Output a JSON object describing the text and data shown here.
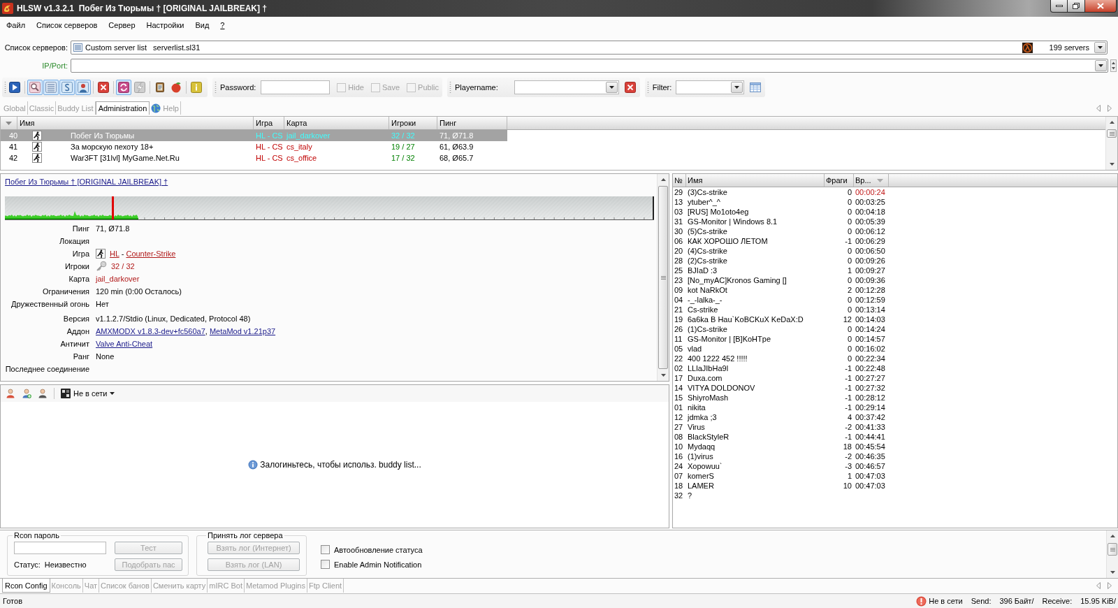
{
  "window": {
    "title": "HLSW v1.3.2.1  Побег Из Тюрьмы † [ORIGINAL JAILBREAK] †"
  },
  "menu": [
    {
      "label": "Файл",
      "underlined": false
    },
    {
      "label": "Список серверов",
      "underlined": false
    },
    {
      "label": "Сервер",
      "underlined": false
    },
    {
      "label": "Настройки",
      "underlined": false
    },
    {
      "label": "Вид",
      "underlined": false
    },
    {
      "label": "?",
      "underlined": true
    }
  ],
  "server_list": {
    "label": "Список серверов:",
    "list_type": "Custom server list",
    "file": "serverlist.sl31",
    "count": "199 servers"
  },
  "ip_port": {
    "label": "IP/Port:"
  },
  "toolbar": {
    "button_groups": [
      [
        {
          "pressed": false,
          "disabled": false
        }
      ],
      [
        {
          "pressed": true,
          "disabled": false
        },
        {
          "pressed": true,
          "disabled": false
        },
        {
          "pressed": true,
          "disabled": false
        },
        {
          "pressed": true,
          "disabled": false
        }
      ],
      [
        {
          "pressed": false,
          "disabled": false
        }
      ],
      [
        {
          "pressed": true,
          "disabled": false
        },
        {
          "pressed": false,
          "disabled": true
        }
      ],
      [
        {
          "pressed": false,
          "disabled": false
        },
        {
          "pressed": false,
          "disabled": false
        }
      ],
      [
        {
          "pressed": false,
          "disabled": false
        }
      ]
    ],
    "password": {
      "label": "Password:",
      "options": [
        {
          "label": "Hide",
          "checked": false,
          "disabled": true
        },
        {
          "label": "Save",
          "checked": false,
          "disabled": true
        },
        {
          "label": "Public",
          "checked": false,
          "disabled": true
        }
      ]
    },
    "playername": {
      "label": "Playername:"
    },
    "filter": {
      "label": "Filter:"
    }
  },
  "view_tabs": [
    {
      "label": "Global",
      "kind": "plain",
      "selected": false
    },
    {
      "label": "Classic",
      "kind": "plain",
      "selected": false
    },
    {
      "label": "Buddy List",
      "kind": "plain",
      "selected": false
    },
    {
      "label": "Administration",
      "kind": "plain",
      "selected": true
    },
    {
      "label": "Help",
      "kind": "web",
      "selected": false
    }
  ],
  "server_table": {
    "columns": [
      "Имя",
      "Игра",
      "Карта",
      "Игроки",
      "Пинг"
    ],
    "rows": [
      {
        "number": "40",
        "name": "Побег Из Тюрьмы",
        "game": "HL - CS",
        "map": "jail_darkover",
        "players": "32 / 32",
        "full": true,
        "ping": "71, Ø71.8",
        "selected": true
      },
      {
        "number": "41",
        "name": "За  морскую пехоту 18+",
        "game": "HL - CS",
        "map": "cs_italy",
        "players": "19 / 27",
        "full": false,
        "ping": "61, Ø63.9",
        "selected": false
      },
      {
        "number": "42",
        "name": "War3FT [31lvl] MyGame.Net.Ru",
        "game": "HL - CS",
        "map": "cs_office",
        "players": "17 / 32",
        "full": false,
        "ping": "68, Ø65.7",
        "selected": false
      }
    ]
  },
  "details": {
    "title": "Побег Из Тюрьмы † [ORIGINAL JAILBREAK] †",
    "field_groups": [
      [
        {
          "kind": "text",
          "label": "Пинг",
          "value": "71, Ø71.8"
        },
        {
          "kind": "text",
          "label": "Локация"
        },
        {
          "kind": "game",
          "label": "Игра",
          "links": [
            "HL",
            "Counter-Strike"
          ],
          "separator": " - "
        },
        {
          "kind": "players",
          "label": "Игроки",
          "value": "32 / 32"
        },
        {
          "kind": "map",
          "label": "Карта",
          "value": "jail_darkover"
        },
        {
          "kind": "text",
          "label": "Ограничения",
          "value": "120 min (0:00 Осталось)"
        },
        {
          "kind": "text",
          "label": "Дружественный огонь",
          "value": "Нет"
        }
      ],
      [
        {
          "kind": "text",
          "label": "Версия",
          "value": "v1.1.2.7/Stdio (Linux, Dedicated, Protocol 48)"
        },
        {
          "kind": "links",
          "label": "Аддон",
          "links": [
            "AMXMODX v1.8.3-dev+fc560a7",
            "MetaMod v1.21p37"
          ],
          "separator": ", "
        },
        {
          "kind": "links",
          "label": "Античит",
          "links": [
            "Valve Anti-Cheat"
          ]
        },
        {
          "kind": "text",
          "label": "Ранг",
          "value": "None"
        },
        {
          "kind": "text",
          "label": "Последнее соединение"
        }
      ]
    ]
  },
  "buddy_list": {
    "status": "Не в сети",
    "message": "Залогиньтесь, чтобы использ. buddy list..."
  },
  "players": {
    "columns": [
      "№",
      "Имя",
      "Фраги",
      "Вр..."
    ],
    "rows": [
      {
        "number": "29",
        "name": "(3)Cs-strike",
        "frags": "0",
        "time": "00:00:24",
        "highlighted": true
      },
      {
        "number": "13",
        "name": "ytuber^_^",
        "frags": "0",
        "time": "00:03:25",
        "highlighted": false
      },
      {
        "number": "03",
        "name": "[RUS] Mo1oto4eg",
        "frags": "0",
        "time": "00:04:18",
        "highlighted": false
      },
      {
        "number": "31",
        "name": "GS-Monitor | Windows 8.1",
        "frags": "0",
        "time": "00:05:39",
        "highlighted": false
      },
      {
        "number": "30",
        "name": "(5)Cs-strike",
        "frags": "0",
        "time": "00:06:12",
        "highlighted": false
      },
      {
        "number": "06",
        "name": "КАК ХОРОШО ЛЕТОМ",
        "frags": "-1",
        "time": "00:06:29",
        "highlighted": false
      },
      {
        "number": "20",
        "name": "(4)Cs-strike",
        "frags": "0",
        "time": "00:06:50",
        "highlighted": false
      },
      {
        "number": "28",
        "name": "(2)Cs-strike",
        "frags": "0",
        "time": "00:09:26",
        "highlighted": false
      },
      {
        "number": "25",
        "name": "BJIaD :3",
        "frags": "1",
        "time": "00:09:27",
        "highlighted": false
      },
      {
        "number": "23",
        "name": "[No_myAC]Kronos Gaming []",
        "frags": "0",
        "time": "00:09:36",
        "highlighted": false
      },
      {
        "number": "09",
        "name": "kot NaRkOt",
        "frags": "2",
        "time": "00:12:28",
        "highlighted": false
      },
      {
        "number": "04",
        "name": "-_-lalka-_-",
        "frags": "0",
        "time": "00:12:59",
        "highlighted": false
      },
      {
        "number": "21",
        "name": "Cs-strike",
        "frags": "0",
        "time": "00:13:14",
        "highlighted": false
      },
      {
        "number": "19",
        "name": "6a6ka B Hau`KoBCKuX KeDaX:D",
        "frags": "12",
        "time": "00:14:03",
        "highlighted": false
      },
      {
        "number": "26",
        "name": "(1)Cs-strike",
        "frags": "0",
        "time": "00:14:24",
        "highlighted": false
      },
      {
        "number": "11",
        "name": "GS-Monitor | [B]KoHTpe",
        "frags": "0",
        "time": "00:14:57",
        "highlighted": false
      },
      {
        "number": "05",
        "name": "vlad",
        "frags": "0",
        "time": "00:16:02",
        "highlighted": false
      },
      {
        "number": "22",
        "name": "400 1222 452 !!!!!",
        "frags": "0",
        "time": "00:22:34",
        "highlighted": false
      },
      {
        "number": "02",
        "name": "LLlaJIbHa9l",
        "frags": "-1",
        "time": "00:22:48",
        "highlighted": false
      },
      {
        "number": "17",
        "name": "Duxa.com",
        "frags": "-1",
        "time": "00:27:27",
        "highlighted": false
      },
      {
        "number": "14",
        "name": "VITYA DOLDONOV",
        "frags": "-1",
        "time": "00:27:32",
        "highlighted": false
      },
      {
        "number": "15",
        "name": "ShiyroMash",
        "frags": "-1",
        "time": "00:28:12",
        "highlighted": false
      },
      {
        "number": "01",
        "name": "nikita",
        "frags": "-1",
        "time": "00:29:14",
        "highlighted": false
      },
      {
        "number": "12",
        "name": "jdmka ;3",
        "frags": "4",
        "time": "00:37:42",
        "highlighted": false
      },
      {
        "number": "27",
        "name": "Virus",
        "frags": "-2",
        "time": "00:41:33",
        "highlighted": false
      },
      {
        "number": "08",
        "name": "BlackStyleR",
        "frags": "-1",
        "time": "00:44:41",
        "highlighted": false
      },
      {
        "number": "10",
        "name": "Mydaqq",
        "frags": "18",
        "time": "00:45:54",
        "highlighted": false
      },
      {
        "number": "16",
        "name": "(1)virus",
        "frags": "-2",
        "time": "00:46:35",
        "highlighted": false
      },
      {
        "number": "24",
        "name": "Xopowuu`",
        "frags": "-3",
        "time": "00:46:57",
        "highlighted": false
      },
      {
        "number": "07",
        "name": "komerS",
        "frags": "1",
        "time": "00:47:03",
        "highlighted": false
      },
      {
        "number": "18",
        "name": "LAMER",
        "frags": "10",
        "time": "00:47:03",
        "highlighted": false
      },
      {
        "number": "32",
        "name": "?",
        "highlighted": false
      }
    ]
  },
  "rcon": {
    "password_group": {
      "title": "Rcon пароль",
      "test_button": {
        "label": "Тест",
        "disabled": true
      },
      "status_label": "Статус:",
      "status_value": "Неизвестно",
      "guess_button": {
        "label": "Подобрать пас",
        "disabled": true
      }
    },
    "log_group": {
      "title": "Принять лог сервера",
      "buttons": [
        {
          "label": "Взять лог (Интернет)",
          "disabled": true
        },
        {
          "label": "Взять лог (LAN)",
          "disabled": true
        }
      ]
    },
    "options": [
      {
        "label": "Автообновление статуса",
        "checked": false
      },
      {
        "label": "Enable Admin Notification",
        "checked": false
      }
    ]
  },
  "bottom_tabs": [
    {
      "label": "Rcon Config",
      "selected": true
    },
    {
      "label": "Консоль",
      "selected": false
    },
    {
      "label": "Чат",
      "selected": false
    },
    {
      "label": "Список банов",
      "selected": false
    },
    {
      "label": "Сменить карту",
      "selected": false
    },
    {
      "label": "mIRC Bot",
      "selected": false
    },
    {
      "label": "Metamod Plugins",
      "selected": false
    },
    {
      "label": "Ftp Client",
      "selected": false
    }
  ],
  "status_bar": {
    "text": "Готов",
    "connection": "Не в сети",
    "send_label": "Send:",
    "send_value": "396 Байт/",
    "receive_label": "Receive:",
    "receive_value": "15.95 KiB/"
  }
}
